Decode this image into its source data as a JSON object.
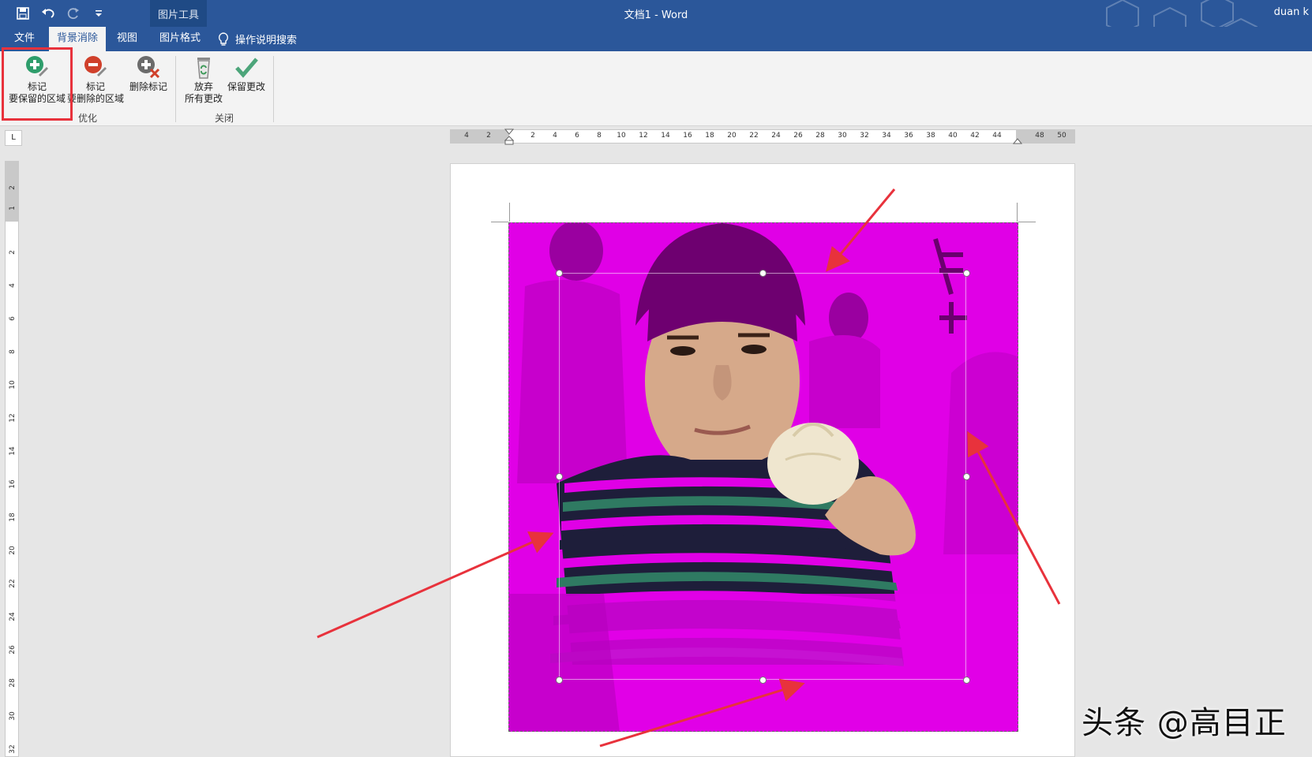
{
  "app": {
    "window_title": "文档1  -  Word",
    "context_tool": "图片工具",
    "user": "duan k"
  },
  "tabs": [
    {
      "label": "文件",
      "active": false
    },
    {
      "label": "背景消除",
      "active": true
    },
    {
      "label": "视图",
      "active": false
    },
    {
      "label": "图片格式",
      "active": false
    }
  ],
  "tell_me": "操作说明搜索",
  "ribbon": {
    "groups": [
      {
        "label": "优化",
        "buttons": [
          {
            "line1": "标记",
            "line2": "要保留的区域",
            "icon": "plus-pencil-icon",
            "color": "#2e9d6b"
          },
          {
            "line1": "标记",
            "line2": "要删除的区域",
            "icon": "minus-pencil-icon",
            "color": "#d0402b"
          },
          {
            "line1": "删除标记",
            "line2": "",
            "icon": "delete-mark-icon",
            "color": "#666666"
          }
        ]
      },
      {
        "label": "关闭",
        "buttons": [
          {
            "line1": "放弃",
            "line2": "所有更改",
            "icon": "recycle-bin-icon",
            "color": "#5a8a5a"
          },
          {
            "line1": "保留更改",
            "line2": "",
            "icon": "checkmark-icon",
            "color": "#4ca57a"
          }
        ]
      }
    ]
  },
  "rulers": {
    "horizontal": [
      "4",
      "2",
      "2",
      "4",
      "6",
      "8",
      "10",
      "12",
      "14",
      "16",
      "18",
      "20",
      "22",
      "24",
      "26",
      "28",
      "30",
      "32",
      "34",
      "36",
      "38",
      "40",
      "42",
      "44",
      "48",
      "50"
    ],
    "vertical": [
      "2",
      "1",
      "2",
      "4",
      "6",
      "8",
      "10",
      "12",
      "14",
      "16",
      "18",
      "20",
      "22",
      "24",
      "26",
      "28",
      "30",
      "32"
    ]
  },
  "ruler_corner": "L",
  "colors": {
    "title_bar": "#2b579a",
    "removal_overlay": "#e000e6",
    "annotation_arrow": "#e8323c"
  },
  "watermark": "头条 @高目正"
}
